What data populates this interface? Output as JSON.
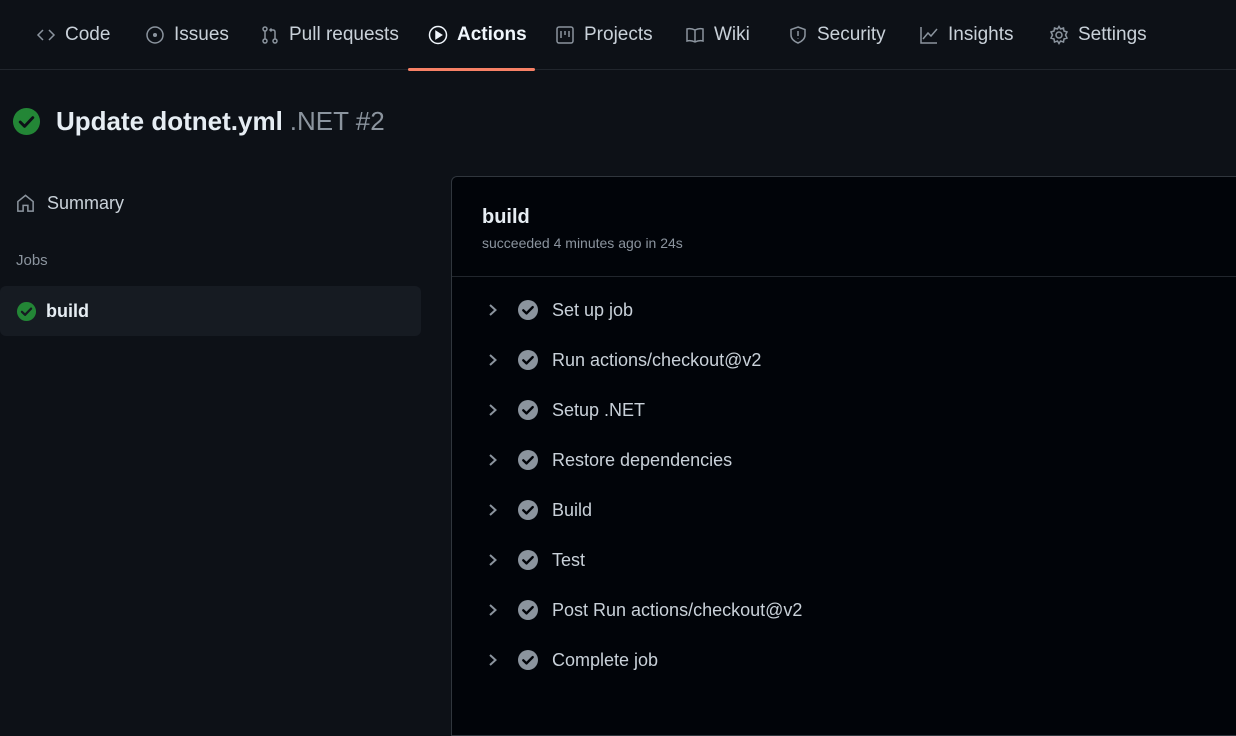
{
  "nav": {
    "tabs": [
      {
        "label": "Code",
        "icon": "code-icon"
      },
      {
        "label": "Issues",
        "icon": "issue-icon"
      },
      {
        "label": "Pull requests",
        "icon": "pull-request-icon"
      },
      {
        "label": "Actions",
        "icon": "play-icon",
        "active": true
      },
      {
        "label": "Projects",
        "icon": "project-icon"
      },
      {
        "label": "Wiki",
        "icon": "book-icon"
      },
      {
        "label": "Security",
        "icon": "shield-icon"
      },
      {
        "label": "Insights",
        "icon": "graph-icon"
      },
      {
        "label": "Settings",
        "icon": "gear-icon"
      }
    ]
  },
  "run": {
    "title": "Update dotnet.yml",
    "suffix": ".NET #2",
    "status_icon": "check-circle-icon"
  },
  "sidebar": {
    "summary_label": "Summary",
    "jobs_label": "Jobs",
    "job": {
      "label": "build",
      "status": "success"
    }
  },
  "job_panel": {
    "title": "build",
    "status_text": "succeeded 4 minutes ago in 24s",
    "steps": [
      {
        "label": "Set up job"
      },
      {
        "label": "Run actions/checkout@v2"
      },
      {
        "label": "Setup .NET"
      },
      {
        "label": "Restore dependencies"
      },
      {
        "label": "Build"
      },
      {
        "label": "Test"
      },
      {
        "label": "Post Run actions/checkout@v2"
      },
      {
        "label": "Complete job"
      }
    ]
  },
  "colors": {
    "background": "#0d1117",
    "success": "#238636",
    "step_check": "#8b949e",
    "active_underline": "#f78166"
  }
}
